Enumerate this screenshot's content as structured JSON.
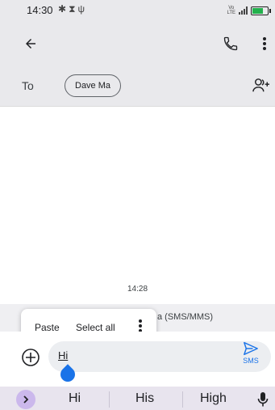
{
  "status_bar": {
    "time": "14:30",
    "left_icons": [
      "gear-icon",
      "hourglass-icon",
      "usb-icon"
    ],
    "volte": "Vo LTE",
    "battery_color": "#22b14c"
  },
  "app_bar": {
    "back_icon": "arrow-left-icon",
    "call_icon": "phone-icon",
    "more_icon": "more-vertical-icon"
  },
  "recipients": {
    "to_label": "To",
    "chip_label": "Dave Ma",
    "add_icon": "add-contact-icon"
  },
  "conversation": {
    "timestamp": "14:28",
    "sms_hint": "a (SMS/MMS)"
  },
  "context_menu": {
    "paste": "Paste",
    "select_all": "Select all"
  },
  "compose": {
    "text": "Hi",
    "send_label": "SMS",
    "accent": "#1a73e8"
  },
  "keyboard": {
    "suggestions": [
      "Hi",
      "His",
      "High"
    ],
    "expand_color": "#cbb8ec"
  }
}
